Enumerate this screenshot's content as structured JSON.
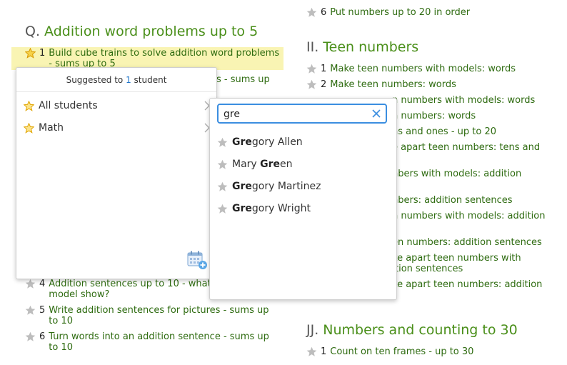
{
  "left_column": {
    "top_partial_item": {
      "text": ""
    },
    "section_q": {
      "letter": "Q.",
      "title": "Addition word problems up to 5"
    },
    "items_before_popup": [
      {
        "num": "1",
        "name": "Build cube trains to solve addition word problems",
        "name_line2": "- sums up to 5"
      },
      {
        "name_partial": "s - sums up"
      }
    ],
    "items_after_popup": [
      {
        "num": "4",
        "name": "Addition sentences up to 10 - what",
        "name_line2": "model show?"
      },
      {
        "num": "5",
        "name": "Write addition sentences for pictures - sums up",
        "name_line2": "to 10"
      },
      {
        "num": "6",
        "name": "Turn words into an addition sentence - sums up",
        "name_line2": "to 10"
      }
    ]
  },
  "right_column": {
    "top_item": {
      "num": "6",
      "name": "Put numbers up to 20 in order"
    },
    "section_ii": {
      "letter": "II.",
      "title": "Teen numbers"
    },
    "teen_items": [
      {
        "num": "1",
        "name": "Make teen numbers with models: words"
      },
      {
        "num": "2",
        "name": "Make teen numbers: words"
      },
      {
        "name": "n numbers with models: words"
      },
      {
        "name": "n numbers: words"
      },
      {
        "name": "ns and ones - up to 20"
      },
      {
        "name": "e apart teen numbers: tens and"
      },
      {
        "name": "nbers with models: addition"
      },
      {
        "name": "nbers: addition sentences"
      },
      {
        "name": "n numbers with models: addition"
      },
      {
        "name": "en numbers: addition sentences"
      },
      {
        "name": "ke apart teen numbers with"
      },
      {
        "name": "tion sentences"
      },
      {
        "name": "ke apart teen numbers: addition"
      }
    ],
    "section_jj": {
      "letter": "JJ.",
      "title": "Numbers and counting to 30"
    },
    "jj_items": [
      {
        "num": "1",
        "name": "Count on ten frames - up to 30"
      }
    ]
  },
  "suggest_popup": {
    "header_prefix": "Suggested to",
    "header_count": "1",
    "header_suffix": "student",
    "menu": [
      {
        "label": "All students"
      },
      {
        "label": "Math"
      }
    ],
    "calendar_icon": "calendar-add-icon"
  },
  "search_panel": {
    "query": "gre",
    "results": [
      {
        "match": "Gre",
        "rest": "gory Allen",
        "prefix": ""
      },
      {
        "prefix": "Mary ",
        "match": "Gre",
        "rest": "en"
      },
      {
        "match": "Gre",
        "rest": "gory Martinez",
        "prefix": ""
      },
      {
        "match": "Gre",
        "rest": "gory Wright",
        "prefix": ""
      }
    ]
  },
  "colors": {
    "accent_green": "#4a8f1a",
    "link_green": "#2e6b10",
    "highlight": "#f9f4b3",
    "focus_blue": "#3b8ee0",
    "star_gold": "#f0b400",
    "star_gray": "#b8b8b8"
  }
}
